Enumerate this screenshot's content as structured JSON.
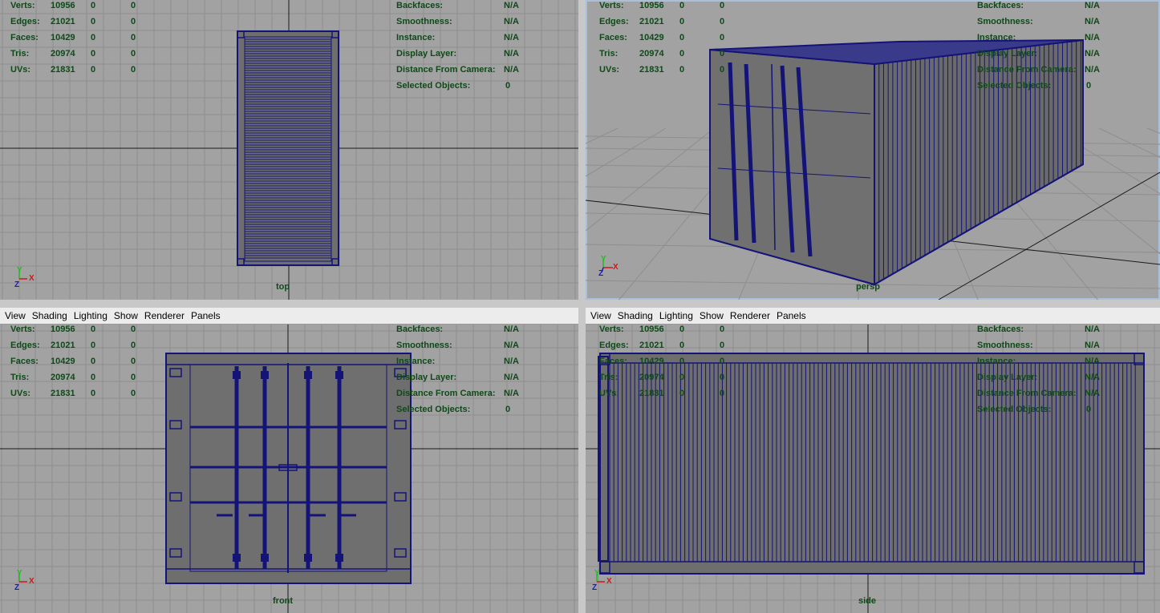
{
  "menu": [
    "View",
    "Shading",
    "Lighting",
    "Show",
    "Renderer",
    "Panels"
  ],
  "hud_left": {
    "labels": [
      "Verts:",
      "Edges:",
      "Faces:",
      "Tris:",
      "UVs:"
    ],
    "values": [
      "10956",
      "21021",
      "10429",
      "20974",
      "21831"
    ],
    "sel": [
      "0",
      "0",
      "0",
      "0",
      "0"
    ],
    "comp": [
      "0",
      "0",
      "0",
      "0",
      "0"
    ]
  },
  "hud_right": {
    "labels": [
      "Backfaces:",
      "Smoothness:",
      "Instance:",
      "Display Layer:",
      "Distance From Camera:",
      "Selected Objects:"
    ],
    "values": [
      "N/A",
      "N/A",
      "N/A",
      "N/A",
      "N/A",
      "0"
    ]
  },
  "viewports": {
    "top": "top",
    "persp": "persp",
    "front": "front",
    "side": "side"
  },
  "axes": {
    "x": "X",
    "y": "Y",
    "z": "Z"
  },
  "colors": {
    "viewport_bg": "#a2a2a2",
    "grid": "#8e8e8e",
    "grid_axis": "#1a1a1a",
    "wire": "#141478",
    "shaded": "#6e6e6e",
    "hud_text": "#0d4a18",
    "axis_x": "#d01818",
    "axis_y": "#18c018",
    "axis_z": "#1818d0"
  }
}
